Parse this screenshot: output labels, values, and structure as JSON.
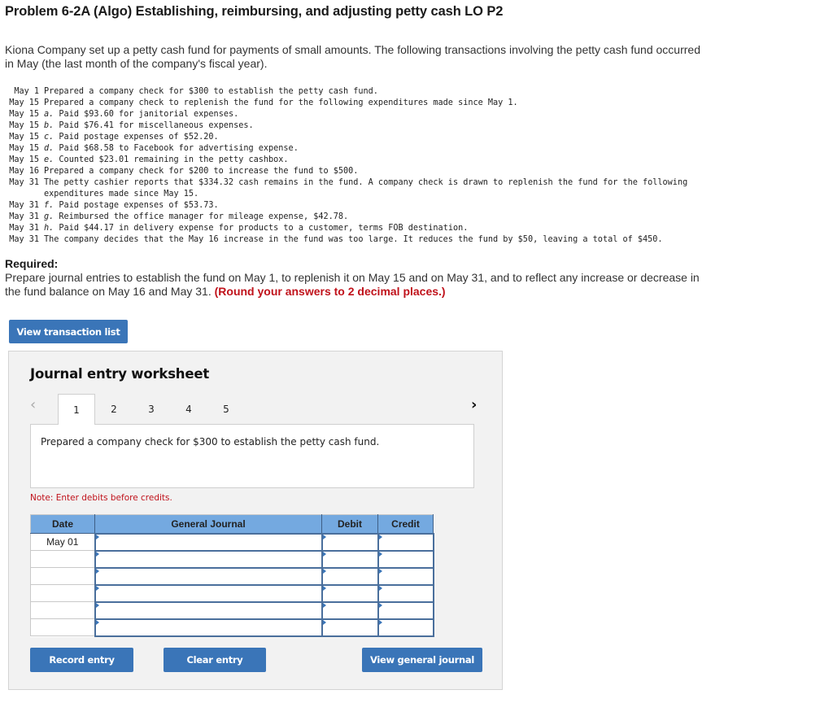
{
  "problem": {
    "title": "Problem 6-2A (Algo) Establishing, reimbursing, and adjusting petty cash LO P2",
    "intro": "Kiona Company set up a petty cash fund for payments of small amounts. The following transactions involving the petty cash fund occurred in May (the last month of the company's fiscal year)."
  },
  "transactions": [
    {
      "date": "May 1",
      "letter": "",
      "text": "Prepared a company check for $300 to establish the petty cash fund."
    },
    {
      "date": "May 15",
      "letter": "",
      "text": "Prepared a company check to replenish the fund for the following expenditures made since May 1."
    },
    {
      "date": "May 15",
      "letter": "a.",
      "text": "Paid $93.60 for janitorial expenses."
    },
    {
      "date": "May 15",
      "letter": "b.",
      "text": "Paid $76.41 for miscellaneous expenses."
    },
    {
      "date": "May 15",
      "letter": "c.",
      "text": "Paid postage expenses of $52.20."
    },
    {
      "date": "May 15",
      "letter": "d.",
      "text": "Paid $68.58 to Facebook for advertising expense."
    },
    {
      "date": "May 15",
      "letter": "e.",
      "text": "Counted $23.01 remaining in the petty cashbox."
    },
    {
      "date": "May 16",
      "letter": "",
      "text": "Prepared a company check for $200 to increase the fund to $500."
    },
    {
      "date": "May 31",
      "letter": "",
      "text": "The petty cashier reports that $334.32 cash remains in the fund. A company check is drawn to replenish the fund for the following expenditures made since May 15."
    },
    {
      "date": "May 31",
      "letter": "f.",
      "text": "Paid postage expenses of $53.73."
    },
    {
      "date": "May 31",
      "letter": "g.",
      "text": "Reimbursed the office manager for mileage expense, $42.78."
    },
    {
      "date": "May 31",
      "letter": "h.",
      "text": "Paid $44.17 in delivery expense for products to a customer, terms FOB destination."
    },
    {
      "date": "May 31",
      "letter": "",
      "text": "The company decides that the May 16 increase in the fund was too large. It reduces the fund by $50, leaving a total of $450."
    }
  ],
  "required": {
    "label": "Required:",
    "text": "Prepare journal entries to establish the fund on May 1, to replenish it on May 15 and on May 31, and to reflect any increase or decrease in the fund balance on May 16 and May 31.",
    "note": "(Round your answers to 2 decimal places.)"
  },
  "buttons": {
    "view_transaction_list": "View transaction list",
    "record_entry": "Record entry",
    "clear_entry": "Clear entry",
    "view_general_journal": "View general journal"
  },
  "worksheet": {
    "title": "Journal entry worksheet",
    "prev_icon": "‹",
    "next_icon": "›",
    "tabs": [
      "1",
      "2",
      "3",
      "4",
      "5"
    ],
    "active_tab": "1",
    "description": "Prepared a company check for $300 to establish the petty cash fund.",
    "note": "Note: Enter debits before credits.",
    "columns": [
      "Date",
      "General Journal",
      "Debit",
      "Credit"
    ],
    "rows": [
      {
        "date": "May 01",
        "account": "",
        "debit": "",
        "credit": ""
      },
      {
        "date": "",
        "account": "",
        "debit": "",
        "credit": ""
      },
      {
        "date": "",
        "account": "",
        "debit": "",
        "credit": ""
      },
      {
        "date": "",
        "account": "",
        "debit": "",
        "credit": ""
      },
      {
        "date": "",
        "account": "",
        "debit": "",
        "credit": ""
      },
      {
        "date": "",
        "account": "",
        "debit": "",
        "credit": ""
      }
    ]
  },
  "colors": {
    "button_blue": "#3a75b8",
    "header_blue": "#74a9e0",
    "note_red": "#c0121b"
  }
}
